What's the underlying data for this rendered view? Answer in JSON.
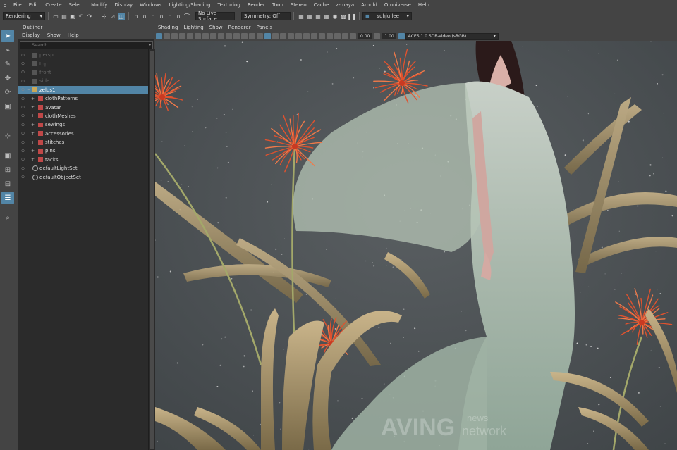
{
  "menubar": {
    "items": [
      "File",
      "Edit",
      "Create",
      "Select",
      "Modify",
      "Display",
      "Windows",
      "Lighting/Shading",
      "Texturing",
      "Render",
      "Toon",
      "Stereo",
      "Cache",
      "z-maya",
      "Arnold",
      "Omniverse",
      "Help"
    ]
  },
  "statusline": {
    "menu_set": "Rendering",
    "live_surface": "No Live Surface",
    "symmetry": "Symmetry: Off",
    "user": "suhju lee"
  },
  "outliner": {
    "title": "Outliner",
    "menu": [
      "Display",
      "Show",
      "Help"
    ],
    "search_placeholder": "Search...",
    "rows": [
      {
        "label": "persp",
        "state": "dim",
        "indent": 0
      },
      {
        "label": "top",
        "state": "dim",
        "indent": 0
      },
      {
        "label": "front",
        "state": "dim",
        "indent": 0
      },
      {
        "label": "side",
        "state": "dim",
        "indent": 0
      },
      {
        "label": "zelus1",
        "state": "sel",
        "indent": 0
      },
      {
        "label": "clothPatterns",
        "state": "",
        "indent": 1
      },
      {
        "label": "avatar",
        "state": "",
        "indent": 1
      },
      {
        "label": "clothMeshes",
        "state": "",
        "indent": 1
      },
      {
        "label": "sewings",
        "state": "",
        "indent": 1
      },
      {
        "label": "accessories",
        "state": "",
        "indent": 1
      },
      {
        "label": "stitches",
        "state": "",
        "indent": 1
      },
      {
        "label": "pins",
        "state": "",
        "indent": 1
      },
      {
        "label": "tacks",
        "state": "",
        "indent": 1
      },
      {
        "label": "defaultLightSet",
        "state": "",
        "indent": 0
      },
      {
        "label": "defaultObjectSet",
        "state": "",
        "indent": 0
      }
    ]
  },
  "viewport": {
    "menu": [
      "Shading",
      "Lighting",
      "Show",
      "Renderer",
      "Panels"
    ],
    "exposure": "0.00",
    "gamma": "1.00",
    "color_space": "ACES 1.0 SDR-video (sRGB)",
    "watermark_main": "AVING",
    "watermark_sub1": "news",
    "watermark_sub2": "network"
  },
  "colors": {
    "accent": "#5285a6",
    "panel": "#444444",
    "dark": "#2b2b2b",
    "sky": "#4b5053"
  }
}
